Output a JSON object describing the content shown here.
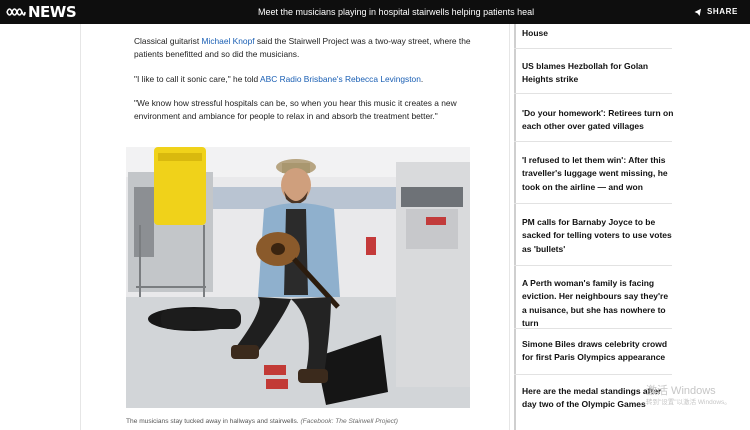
{
  "topbar": {
    "logo_text": "NEWS",
    "headline": "Meet the musicians playing in hospital stairwells helping patients heal",
    "share_label": "SHARE",
    "icons": {
      "logo": "abc-logo-icon",
      "share": "share-icon"
    }
  },
  "article": {
    "p1": {
      "text_a": "Classical guitarist ",
      "link_a": "Michael Knopf",
      "text_b": " said the Stairwell Project was a two-way street, where the patients benefitted and so did the musicians."
    },
    "p2": {
      "text_a": "\"I like to call it sonic care,\" he told ",
      "link_a": "ABC Radio Brisbane's Rebecca Levingston",
      "text_b": "."
    },
    "p3": {
      "text": "\"We know how stressful hospitals can be, so when you hear this music it creates a new environment and ambiance for people to relax in and absorb the treatment better.\""
    },
    "caption": {
      "text": "The musicians stay tucked away in hallways and stairwells. ",
      "credit": "(Facebook: The Stairwell Project)"
    }
  },
  "sidebar": {
    "items": [
      {
        "label": "House"
      },
      {
        "label": "US blames Hezbollah for Golan Heights strike"
      },
      {
        "label": "'Do your homework': Retirees turn on each other over gated villages"
      },
      {
        "label": "'I refused to let them win': After this traveller's luggage went missing, he took on the airline — and won"
      },
      {
        "label": "PM calls for Barnaby Joyce to be sacked for telling voters to use votes as 'bullets'"
      },
      {
        "label": "A Perth woman's family is facing eviction. Her neighbours say they're a nuisance, but she has nowhere to turn"
      },
      {
        "label": "Simone Biles draws celebrity crowd for first Paris Olympics appearance"
      },
      {
        "label": "Here are the medal standings after day two of the Olympic Games"
      }
    ]
  },
  "watermark": {
    "line1": "激活 Windows",
    "line2": "转到\"设置\"以激活 Windows。"
  },
  "colors": {
    "topbar": "#0e0e0e",
    "link": "#1a5fb4"
  }
}
